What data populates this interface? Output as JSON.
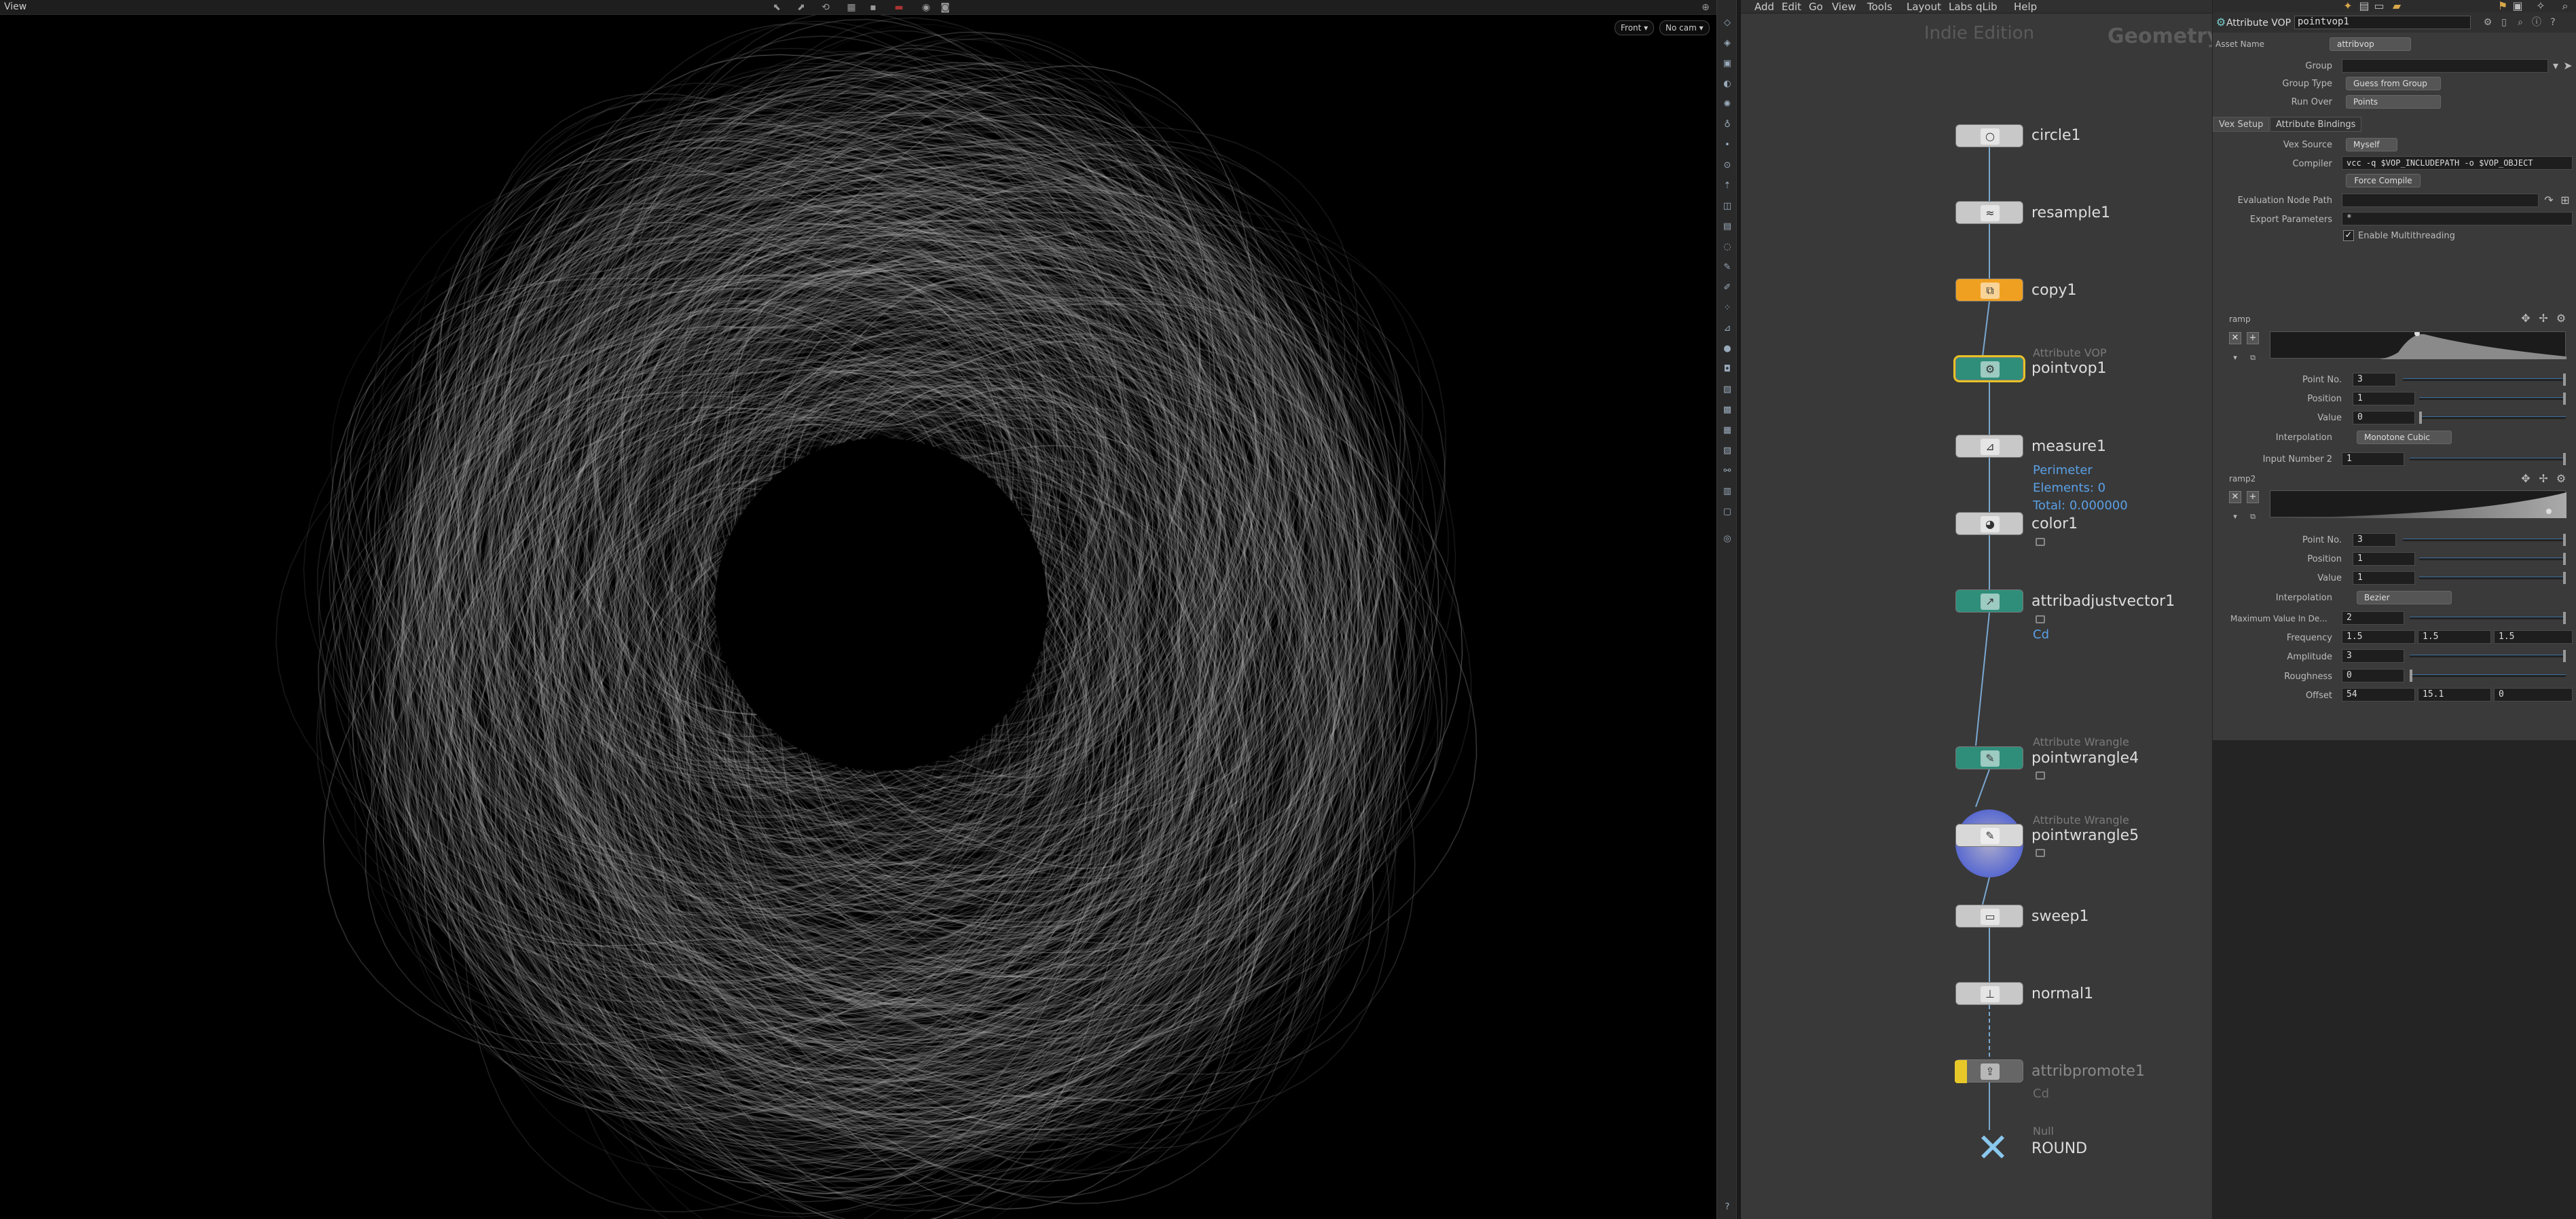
{
  "viewport": {
    "title": "View",
    "view_button": "Front ▾",
    "camera_button": "No cam ▾"
  },
  "network": {
    "menu": [
      "Add",
      "Edit",
      "Go",
      "View",
      "Tools",
      "Layout",
      "Labs",
      "qLib",
      "Help"
    ],
    "edition": "Indie Edition",
    "context": "Geometry",
    "nodes": {
      "circle": {
        "name": "circle1"
      },
      "resample": {
        "name": "resample1"
      },
      "copy": {
        "name": "copy1"
      },
      "pointvop": {
        "type": "Attribute VOP",
        "name": "pointvop1"
      },
      "measure": {
        "name": "measure1",
        "info1": "Perimeter",
        "info2": "Elements: 0",
        "info3": "Total: 0.000000"
      },
      "color": {
        "name": "color1"
      },
      "attribadjust": {
        "name": "attribadjustvector1",
        "info1": "Cd"
      },
      "wrangle4": {
        "type": "Attribute Wrangle",
        "name": "pointwrangle4"
      },
      "wrangle5": {
        "type": "Attribute Wrangle",
        "name": "pointwrangle5"
      },
      "sweep": {
        "name": "sweep1"
      },
      "normal": {
        "name": "normal1"
      },
      "promote": {
        "name": "attribpromote1",
        "info1": "Cd"
      },
      "null": {
        "type": "Null",
        "name": "ROUND"
      }
    }
  },
  "params": {
    "node_type": "Attribute VOP",
    "node_name": "pointvop1",
    "asset_label": "Asset Name",
    "asset_value": "attribvop",
    "group_label": "Group",
    "group_type_label": "Group Type",
    "group_type_value": "Guess from Group",
    "run_over_label": "Run Over",
    "run_over_value": "Points",
    "tabs": [
      "Vex Setup",
      "Attribute Bindings"
    ],
    "vex_source_label": "Vex Source",
    "vex_source_value": "Myself",
    "compiler_label": "Compiler",
    "compiler_value": "vcc -q $VOP_INCLUDEPATH -o $VOP_OBJECT",
    "force_compile": "Force Compile",
    "eval_path_label": "Evaluation Node Path",
    "export_label": "Export Parameters",
    "export_value": "*",
    "multithread_label": "Enable Multithreading",
    "ramp1": {
      "label": "ramp",
      "point_no_label": "Point No.",
      "point_no": "3",
      "position_label": "Position",
      "position": "1",
      "value_label": "Value",
      "value": "0",
      "interp_label": "Interpolation",
      "interp": "Monotone Cubic"
    },
    "input_number_label": "Input Number 2",
    "input_number_value": "1",
    "ramp2": {
      "label": "ramp2",
      "point_no_label": "Point No.",
      "point_no": "3",
      "position_label": "Position",
      "position": "1",
      "value_label": "Value",
      "value": "1",
      "interp_label": "Interpolation",
      "interp": "Bezier"
    },
    "max_value_label": "Maximum Value In De...",
    "max_value": "2",
    "frequency_label": "Frequency",
    "frequency": [
      "1.5",
      "1.5",
      "1.5"
    ],
    "amplitude_label": "Amplitude",
    "amplitude": "3",
    "roughness_label": "Roughness",
    "roughness": "0",
    "offset_label": "Offset",
    "offset": [
      "54",
      "15.1",
      "0"
    ]
  }
}
